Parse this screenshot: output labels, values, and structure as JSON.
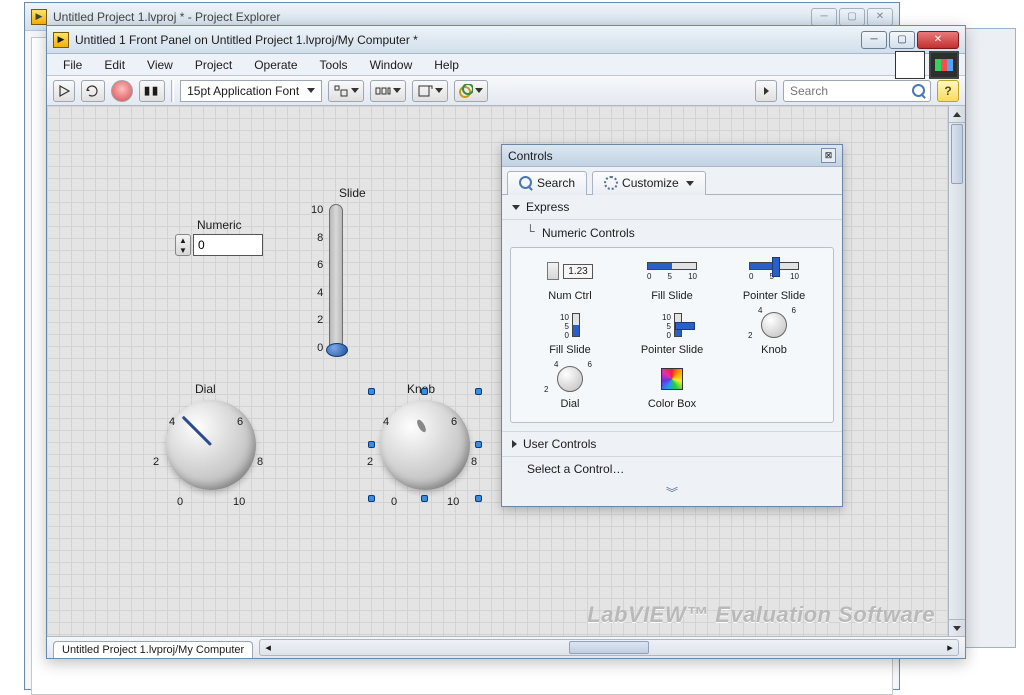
{
  "project_explorer": {
    "title": "Untitled Project 1.lvproj * - Project Explorer"
  },
  "front_panel": {
    "title": "Untitled 1 Front Panel on Untitled Project 1.lvproj/My Computer *",
    "menu": [
      "File",
      "Edit",
      "View",
      "Project",
      "Operate",
      "Tools",
      "Window",
      "Help"
    ],
    "font_selector": "15pt Application Font",
    "search_placeholder": "Search",
    "status_tab": "Untitled Project 1.lvproj/My Computer",
    "watermark": "LabVIEW™ Evaluation Software"
  },
  "widgets": {
    "numeric": {
      "label": "Numeric",
      "value": "0"
    },
    "slide": {
      "label": "Slide",
      "ticks": [
        "10",
        "8",
        "6",
        "4",
        "2",
        "0"
      ]
    },
    "dial": {
      "label": "Dial",
      "nums": [
        "0",
        "2",
        "4",
        "6",
        "8",
        "10"
      ]
    },
    "knob": {
      "label": "Knob",
      "nums": [
        "0",
        "2",
        "4",
        "6",
        "8",
        "10"
      ]
    }
  },
  "palette": {
    "title": "Controls",
    "tab_search": "Search",
    "tab_customize": "Customize",
    "category_express": "Express",
    "sub_heading": "Numeric Controls",
    "items": [
      {
        "label": "Num Ctrl",
        "value": "1.23"
      },
      {
        "label": "Fill Slide",
        "tick": [
          "0",
          "5",
          "10"
        ]
      },
      {
        "label": "Pointer Slide",
        "tick": [
          "0",
          "5",
          "10"
        ]
      },
      {
        "label": "Fill Slide",
        "vtick": [
          "10",
          "5",
          "0"
        ]
      },
      {
        "label": "Pointer Slide",
        "vtick": [
          "10",
          "5",
          "0"
        ]
      },
      {
        "label": "Knob",
        "knum": [
          "2",
          "4",
          "6"
        ]
      },
      {
        "label": "Dial",
        "knum": [
          "2",
          "4",
          "6"
        ]
      },
      {
        "label": "Color Box"
      }
    ],
    "row_user": "User Controls",
    "row_select": "Select a Control…"
  }
}
